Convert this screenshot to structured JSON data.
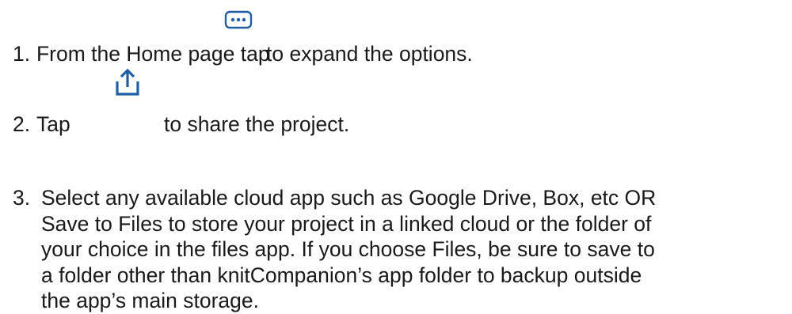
{
  "steps": [
    {
      "number": "1.",
      "before_icon": "From the Home page tap",
      "icon": "more-options-icon",
      "after_icon": "to expand the options."
    },
    {
      "number": "2.",
      "before_icon": "Tap",
      "icon": "share-icon",
      "after_icon": "to share the project."
    },
    {
      "number": "3.",
      "lines": [
        "Select any available cloud app such as Google Drive, Box, etc OR",
        "Save to Files to store your project in a linked cloud or the folder of",
        "your choice in the files app. If you choose Files, be sure to save to",
        "a folder other than knitCompanion’s app folder to backup outside",
        "the app’s main storage."
      ]
    }
  ],
  "colors": {
    "text": "#1a1a1a",
    "icon": "#1f5fa8"
  }
}
